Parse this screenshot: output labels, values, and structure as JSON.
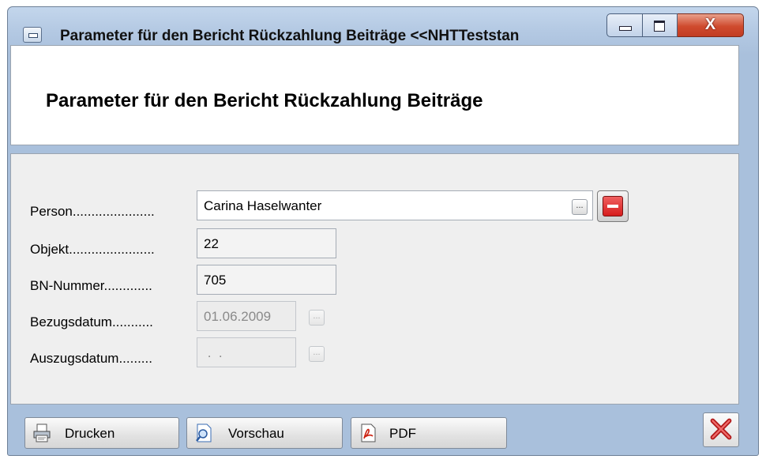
{
  "window": {
    "title": "Parameter für den Bericht Rückzahlung Beiträge  <<NHTTeststan",
    "controls": {
      "minimize_icon": "minimize-icon",
      "maximize_icon": "maximize-icon",
      "close_label": "X"
    }
  },
  "header": {
    "title": "Parameter für den Bericht Rückzahlung Beiträge"
  },
  "form": {
    "person": {
      "label": "Person......................",
      "value": "Carina Haselwanter"
    },
    "objekt": {
      "label": "Objekt.......................",
      "value": "22"
    },
    "bn_nummer": {
      "label": "BN-Nummer.............",
      "value": "705"
    },
    "bezugsdatum": {
      "label": "Bezugsdatum...........",
      "value": "01.06.2009"
    },
    "auszugsdatum": {
      "label": "Auszugsdatum.........",
      "value": " .  ."
    },
    "browse_glyph": "..."
  },
  "buttons": {
    "print": "Drucken",
    "preview": "Vorschau",
    "pdf": "PDF"
  },
  "colors": {
    "accent_red": "#d61c1c",
    "window_frame": "#a9c0dc"
  }
}
